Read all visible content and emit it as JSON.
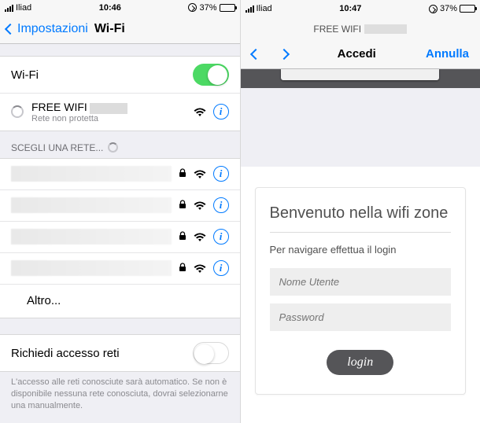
{
  "left": {
    "status": {
      "carrier": "Iliad",
      "time": "10:46",
      "battery_pct": "37%"
    },
    "nav": {
      "back": "Impostazioni",
      "title": "Wi-Fi"
    },
    "wifi_toggle_label": "Wi-Fi",
    "connected": {
      "name": "FREE WIFI",
      "subtitle": "Rete non protetta"
    },
    "choose_header": "SCEGLI UNA RETE...",
    "other": "Altro...",
    "ask_join_label": "Richiedi accesso reti",
    "footer": "L'accesso alle reti conosciute sarà automatico. Se non è disponibile nessuna rete conosciuta, dovrai selezionarne una manualmente."
  },
  "right": {
    "status": {
      "carrier": "Iliad",
      "time": "10:47",
      "battery_pct": "37%"
    },
    "titlebar": "FREE WIFI",
    "toolbar": {
      "center": "Accedi",
      "cancel": "Annulla"
    },
    "login": {
      "title": "Benvenuto nella wifi zone",
      "subtitle": "Per navigare effettua il login",
      "user_placeholder": "Nome Utente",
      "pass_placeholder": "Password",
      "button": "login"
    }
  }
}
